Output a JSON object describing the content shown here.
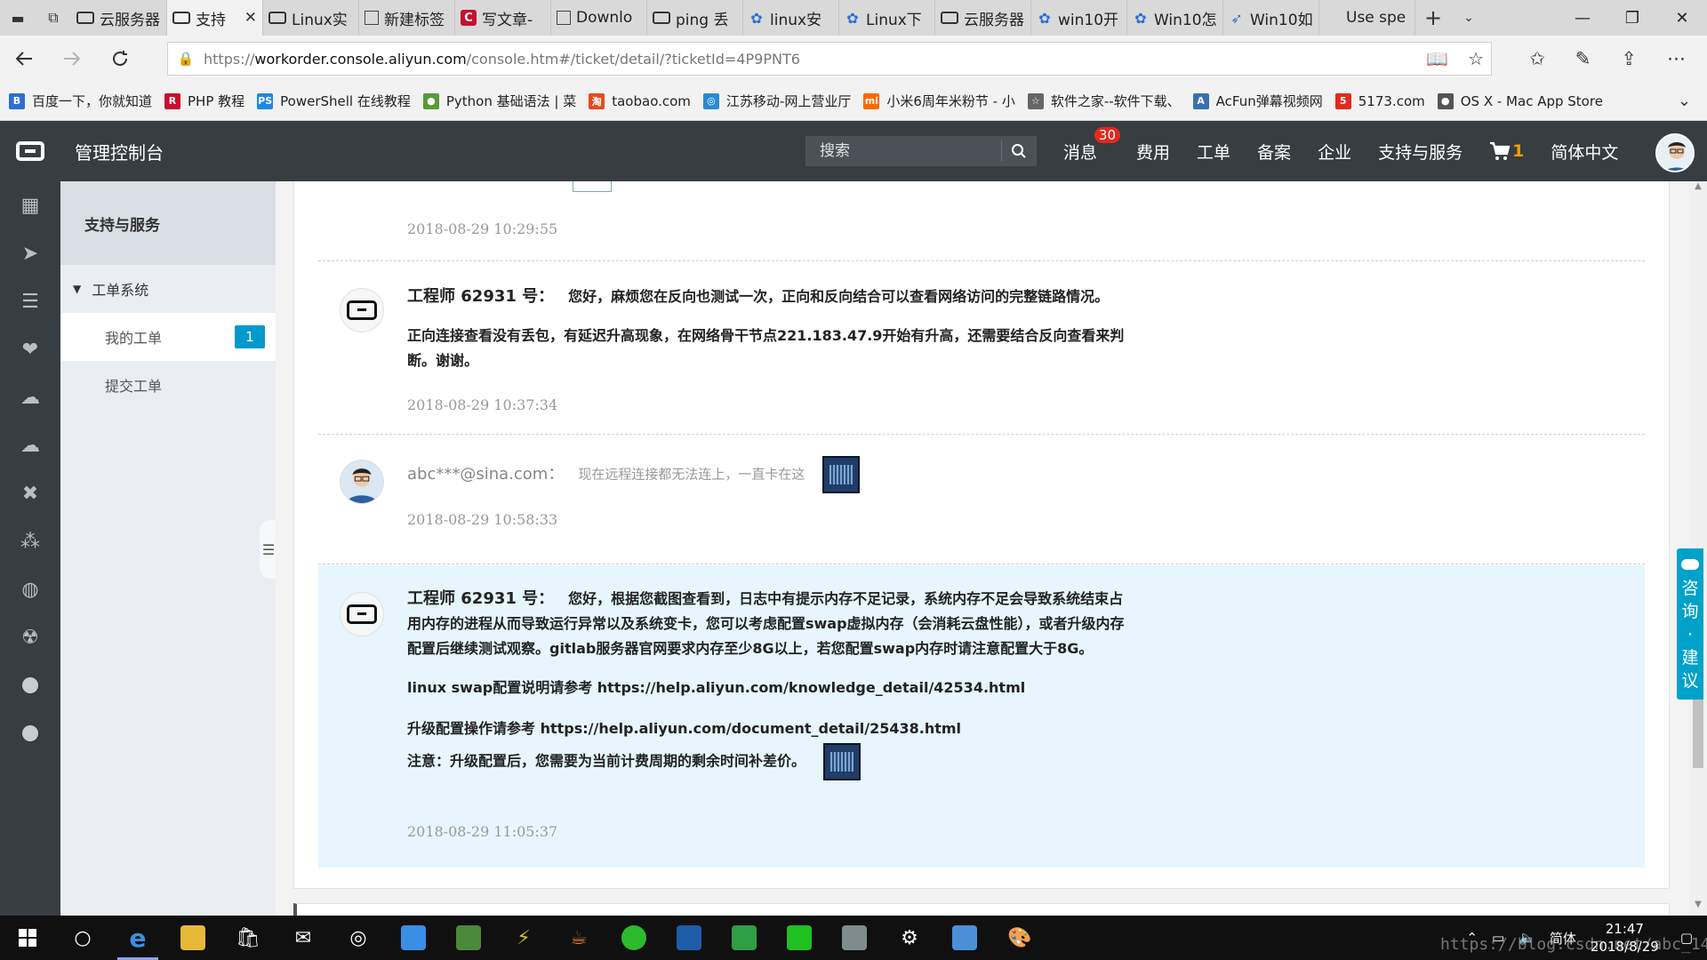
{
  "browser": {
    "tabs": [
      {
        "title": "云服务器",
        "favicon": "aliyun-icon"
      },
      {
        "title": "支持",
        "favicon": "aliyun-icon",
        "active": true
      },
      {
        "title": "Linux实",
        "favicon": "aliyun-icon"
      },
      {
        "title": "新建标签",
        "favicon": "page-icon"
      },
      {
        "title": "写文章-",
        "favicon": "csdn-icon"
      },
      {
        "title": "Downlo",
        "favicon": "page-icon"
      },
      {
        "title": "ping 丢",
        "favicon": "aliyun-icon"
      },
      {
        "title": "linux安",
        "favicon": "baidu-icon"
      },
      {
        "title": "Linux下",
        "favicon": "baidu-icon"
      },
      {
        "title": "云服务器",
        "favicon": "aliyun-icon"
      },
      {
        "title": "win10开",
        "favicon": "baidu-icon"
      },
      {
        "title": "Win10怎",
        "favicon": "baidu-icon"
      },
      {
        "title": "Win10如",
        "favicon": "bird-icon"
      },
      {
        "title": "Use spe",
        "favicon": "microsoft-icon"
      }
    ],
    "url": {
      "protocol": "https://",
      "host": "workorder.console.aliyun.com",
      "path": "/console.htm#/ticket/detail/?ticketId=4P9PNT6"
    },
    "bookmarks": [
      {
        "label": "百度一下，你就知道",
        "color": "#2d6fd6",
        "icon": "B"
      },
      {
        "label": "PHP 教程",
        "color": "#c8102e",
        "icon": "R"
      },
      {
        "label": "PowerShell 在线教程",
        "color": "#1e88e5",
        "icon": "PS"
      },
      {
        "label": "Python 基础语法 | 菜",
        "color": "#5a9a3a",
        "icon": "●"
      },
      {
        "label": "taobao.com",
        "color": "#e8491d",
        "icon": "淘"
      },
      {
        "label": "江苏移动-网上营业厅",
        "color": "#2b8ad1",
        "icon": "◎"
      },
      {
        "label": "小米6周年米粉节 - 小",
        "color": "#ff6700",
        "icon": "mi"
      },
      {
        "label": "软件之家--软件下载、",
        "color": "#666666",
        "icon": "☆"
      },
      {
        "label": "AcFun弹幕视频网",
        "color": "#3a6fb0",
        "icon": "A"
      },
      {
        "label": "5173.com",
        "color": "#e6281e",
        "icon": "5"
      },
      {
        "label": "OS X - Mac App Store",
        "color": "#555555",
        "icon": "●"
      }
    ]
  },
  "console": {
    "title": "管理控制台",
    "search_placeholder": "搜索",
    "nav": {
      "messages": "消息",
      "messages_count": "30",
      "billing": "费用",
      "tickets": "工单",
      "icp": "备案",
      "enterprise": "企业",
      "support": "支持与服务",
      "cart_count": "1",
      "language": "简体中文"
    }
  },
  "sidebar": {
    "heading": "支持与服务",
    "group": "工单系统",
    "items": [
      {
        "label": "我的工单",
        "badge": "1",
        "active": true
      },
      {
        "label": "提交工单"
      }
    ]
  },
  "conversation": {
    "first_timestamp": "2018-08-29 10:29:55",
    "messages": [
      {
        "sender": "工程师 62931 号：",
        "role": "engineer",
        "paragraphs": [
          "您好，麻烦您在反向也测试一次，正向和反向结合可以查看网络访问的完整链路情况。",
          "正向连接查看没有丢包，有延迟升高现象，在网络骨干节点221.183.47.9开始有升高，还需要结合反向查看来判断。谢谢。"
        ],
        "timestamp": "2018-08-29 10:37:34"
      },
      {
        "sender": "abc***@sina.com：",
        "role": "user",
        "paragraphs": [
          "现在远程连接都无法连上，一直卡在这"
        ],
        "timestamp": "2018-08-29 10:58:33"
      },
      {
        "sender": "工程师 62931 号：",
        "role": "engineer",
        "paragraphs": [
          "您好，根据您截图查看到，日志中有提示内存不足记录，系统内存不足会导致系统结束占用内存的进程从而导致运行异常以及系统变卡，您可以考虑配置swap虚拟内存（会消耗云盘性能），或者升级内存配置后继续测试观察。gitlab服务器官网要求内存至少8G以上，若您配置swap内存时请注意配置大于8G。",
          "linux swap配置说明请参考 https://help.aliyun.com/knowledge_detail/42534.html",
          "升级配置操作请参考 https://help.aliyun.com/document_detail/25438.html",
          "注意：升级配置后，您需要为当前计费周期的剩余时间补差价。"
        ],
        "timestamp": "2018-08-29 11:05:37"
      }
    ]
  },
  "feedback_tab": "咨询·建议",
  "taskbar": {
    "ime": "简体",
    "time": "21:47",
    "date": "2018/8/29",
    "watermark": "https://blog.csdn.net/abc_14"
  },
  "colors": {
    "console_bar": "#373d41",
    "accent": "#0099cc",
    "highlight_bg": "#e6f6fc",
    "badge_red": "#e6281e"
  }
}
